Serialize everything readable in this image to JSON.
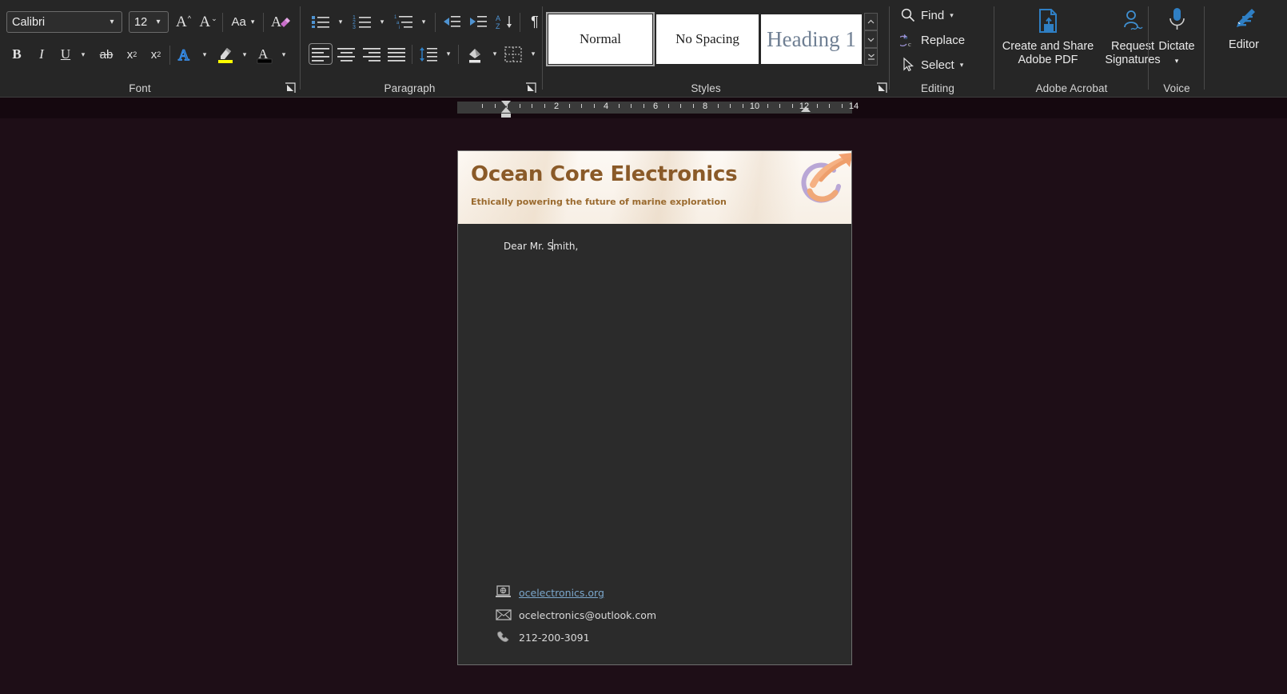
{
  "ribbon": {
    "groups": [
      {
        "name": "font",
        "label": "Font"
      },
      {
        "name": "paragraph",
        "label": "Paragraph"
      },
      {
        "name": "styles",
        "label": "Styles"
      },
      {
        "name": "editing",
        "label": "Editing"
      },
      {
        "name": "acrobat",
        "label": "Adobe Acrobat"
      },
      {
        "name": "voice",
        "label": "Voice"
      }
    ],
    "font": {
      "font_name": "Calibri",
      "font_size": "12",
      "grow_font": "A",
      "shrink_font": "A",
      "change_case": "Aa",
      "clear_formatting": "clear-formatting-icon",
      "bold": "B",
      "italic": "I",
      "underline": "U",
      "strikethrough": "ab",
      "subscript": "x",
      "superscript": "x",
      "text_effects": "A",
      "highlight": "highlight-icon",
      "font_color": "A"
    },
    "paragraph": {
      "bullets": "bullet-list-icon",
      "numbering": "numbered-list-icon",
      "multilevel": "multilevel-list-icon",
      "decrease_indent": "decrease-indent-icon",
      "increase_indent": "increase-indent-icon",
      "sort": "sort-icon",
      "show_marks": "¶",
      "align_left": "align-left-icon",
      "align_center": "align-center-icon",
      "align_right": "align-right-icon",
      "justify": "justify-icon",
      "line_spacing": "line-spacing-icon",
      "shading": "shading-icon",
      "borders": "borders-icon"
    },
    "styles": {
      "items": [
        {
          "label": "Normal",
          "selected": true
        },
        {
          "label": "No Spacing",
          "selected": false
        },
        {
          "label": "Heading 1",
          "selected": false
        }
      ],
      "scroll_up": "▲",
      "scroll_down": "▼",
      "more": "more-styles-icon"
    },
    "editing": {
      "find": "Find",
      "replace": "Replace",
      "select": "Select"
    },
    "acrobat": {
      "create_share_pdf_line1": "Create and Share",
      "create_share_pdf_line2": "Adobe PDF",
      "request_signatures_line1": "Request",
      "request_signatures_line2": "Signatures"
    },
    "voice": {
      "dictate": "Dictate"
    },
    "editor": {
      "label": "Editor"
    }
  },
  "ruler": {
    "numbers": [
      "2",
      "4",
      "6",
      "8",
      "10",
      "12",
      "14"
    ],
    "left_indent_position": "0",
    "right_indent_position": "15.5"
  },
  "document": {
    "letterhead": {
      "company": "Ocean Core Electronics",
      "tagline": "Ethically powering the future of marine exploration",
      "logo": "swoosh-arrow-logo"
    },
    "body": {
      "salutation": "Dear Mr. Smith,"
    },
    "footer": {
      "rows": [
        {
          "icon": "website-icon",
          "text": "ocelectronics.org",
          "is_link": true
        },
        {
          "icon": "email-icon",
          "text": "ocelectronics@outlook.com",
          "is_link": false
        },
        {
          "icon": "phone-icon",
          "text": "212-200-3091",
          "is_link": false
        }
      ]
    }
  },
  "colors": {
    "canvas_background": "#1e0e17",
    "ribbon_background": "#262626",
    "page_background": "#2b2b2b",
    "letterhead_background": "#fdf9f4",
    "brand_brown": "#8a5a28",
    "accent_blue": "#2b7cd3",
    "link_blue": "#7ba7cc",
    "highlight_yellow": "#ffff00"
  }
}
